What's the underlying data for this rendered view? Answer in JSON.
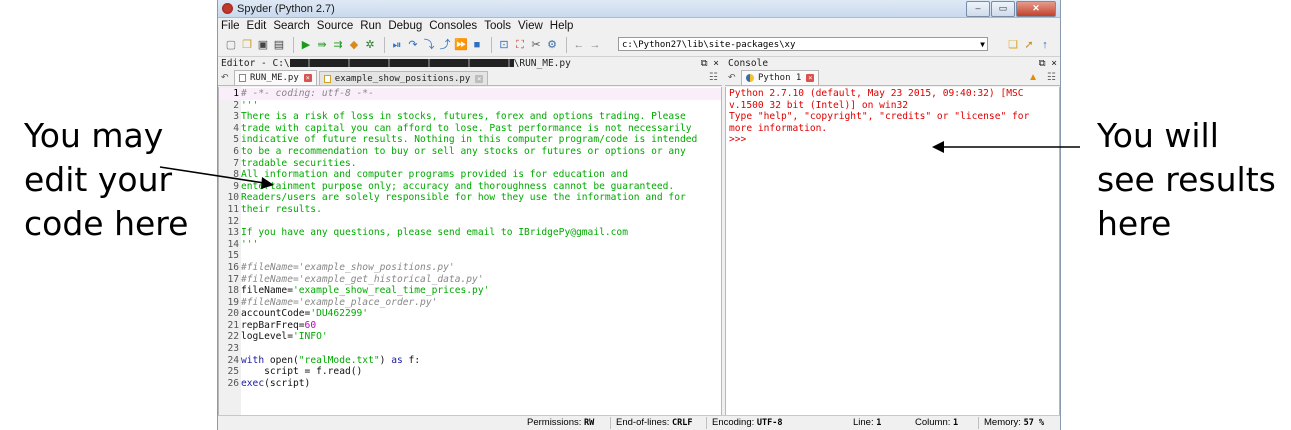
{
  "window": {
    "title": "Spyder (Python 2.7)",
    "controls": [
      "–",
      "▭",
      "✕"
    ]
  },
  "menu": [
    "File",
    "Edit",
    "Search",
    "Source",
    "Run",
    "Debug",
    "Consoles",
    "Tools",
    "View",
    "Help"
  ],
  "toolbar": {
    "path": "c:\\Python27\\lib\\site-packages\\xy"
  },
  "editor": {
    "pane_title": "Editor - C:\\",
    "pane_title_tail": "\\RUN_ME.py",
    "tabs": [
      {
        "label": "RUN_ME.py",
        "active": true
      },
      {
        "label": "example_show_positions.py",
        "active": false
      }
    ],
    "lines": [
      {
        "n": "1",
        "t": "# -*- coding: utf-8 -*-",
        "k": "cmt"
      },
      {
        "n": "2",
        "t": "'''",
        "k": "str"
      },
      {
        "n": "3",
        "t": "There is a risk of loss in stocks, futures, forex and options trading. Please",
        "k": "str"
      },
      {
        "n": "4",
        "t": "trade with capital you can afford to lose. Past performance is not necessarily",
        "k": "str"
      },
      {
        "n": "5",
        "t": "indicative of future results. Nothing in this computer program/code is intended",
        "k": "str"
      },
      {
        "n": "6",
        "t": "to be a recommendation to buy or sell any stocks or futures or options or any",
        "k": "str"
      },
      {
        "n": "7",
        "t": "tradable securities.",
        "k": "str"
      },
      {
        "n": "8",
        "t": "All information and computer programs provided is for education and",
        "k": "str"
      },
      {
        "n": "9",
        "t": "entertainment purpose only; accuracy and thoroughness cannot be guaranteed.",
        "k": "str"
      },
      {
        "n": "10",
        "t": "Readers/users are solely responsible for how they use the information and for",
        "k": "str"
      },
      {
        "n": "11",
        "t": "their results.",
        "k": "str"
      },
      {
        "n": "12",
        "t": "",
        "k": "str"
      },
      {
        "n": "13",
        "t": "If you have any questions, please send email to IBridgePy@gmail.com",
        "k": "str"
      },
      {
        "n": "14",
        "t": "'''",
        "k": "str"
      },
      {
        "n": "15",
        "t": "",
        "k": "def"
      },
      {
        "n": "16",
        "t": "#fileName='example_show_positions.py'",
        "k": "cmt"
      },
      {
        "n": "17",
        "t": "#fileName='example_get_historical_data.py'",
        "k": "cmt"
      },
      {
        "n": "18",
        "t": "fileName='example_show_real_time_prices.py'",
        "k": "assign"
      },
      {
        "n": "19",
        "t": "#fileName='example_place_order.py'",
        "k": "cmt"
      },
      {
        "n": "20",
        "t": "accountCode='DU462299'",
        "k": "assign"
      },
      {
        "n": "21",
        "t": "repBarFreq=60",
        "k": "assignnum"
      },
      {
        "n": "22",
        "t": "logLevel='INFO'",
        "k": "assign"
      },
      {
        "n": "23",
        "t": "",
        "k": "def"
      },
      {
        "n": "24",
        "t": "with open(\"realMode.txt\") as f:",
        "k": "with"
      },
      {
        "n": "25",
        "t": "    script = f.read()",
        "k": "def"
      },
      {
        "n": "26",
        "t": "exec(script)",
        "k": "exec"
      }
    ]
  },
  "console": {
    "pane_title": "Console",
    "tab_label": "Python 1",
    "output": "Python 2.7.10 (default, May 23 2015, 09:40:32) [MSC v.1500 32 bit (Intel)] on win32\nType \"help\", \"copyright\", \"credits\" or \"license\" for more information.\n>>> "
  },
  "status": {
    "permissions_label": "Permissions:",
    "permissions": "RW",
    "eol_label": "End-of-lines:",
    "eol": "CRLF",
    "encoding_label": "Encoding:",
    "encoding": "UTF-8",
    "line_label": "Line:",
    "line": "1",
    "column_label": "Column:",
    "column": "1",
    "memory_label": "Memory:",
    "memory": "57 %"
  },
  "annotations": {
    "left": "You may\nedit your\ncode here",
    "right": "You will\nsee results\nhere"
  },
  "colors": {
    "string": "#00aa00",
    "comment": "#888888",
    "keyword": "#1a1aa6",
    "console_text": "#e00000"
  }
}
